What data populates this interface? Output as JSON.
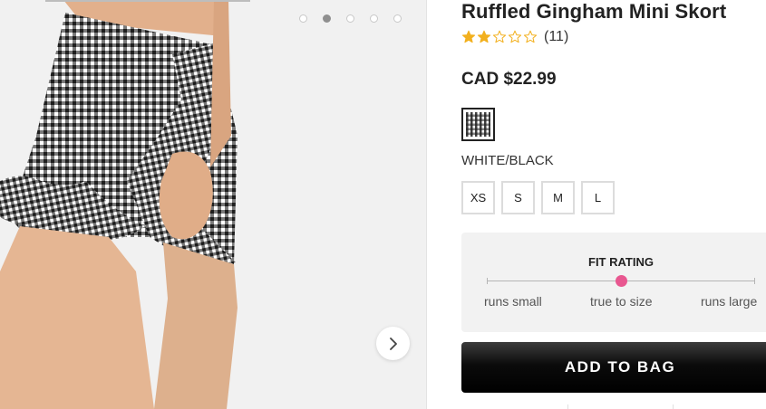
{
  "gallery": {
    "slide_count": 5,
    "active_slide": 2,
    "next_icon": "chevron-right-icon"
  },
  "product": {
    "title": "Ruffled Gingham Mini Skort",
    "rating": 2,
    "rating_max": 5,
    "review_count": "(11)",
    "price": "CAD $22.99",
    "color_name": "WHITE/BLACK",
    "sizes": [
      "XS",
      "S",
      "M",
      "L"
    ]
  },
  "fit_rating": {
    "title": "FIT RATING",
    "value": 0.5,
    "labels": {
      "small": "runs small",
      "true": "true to size",
      "large": "runs large"
    }
  },
  "actions": {
    "add_to_bag": "ADD TO BAG"
  },
  "colors": {
    "star_fill": "#f2b01e",
    "star_outline": "#f2b01e",
    "fit_marker": "#e85790",
    "button_bg": "#000000"
  }
}
